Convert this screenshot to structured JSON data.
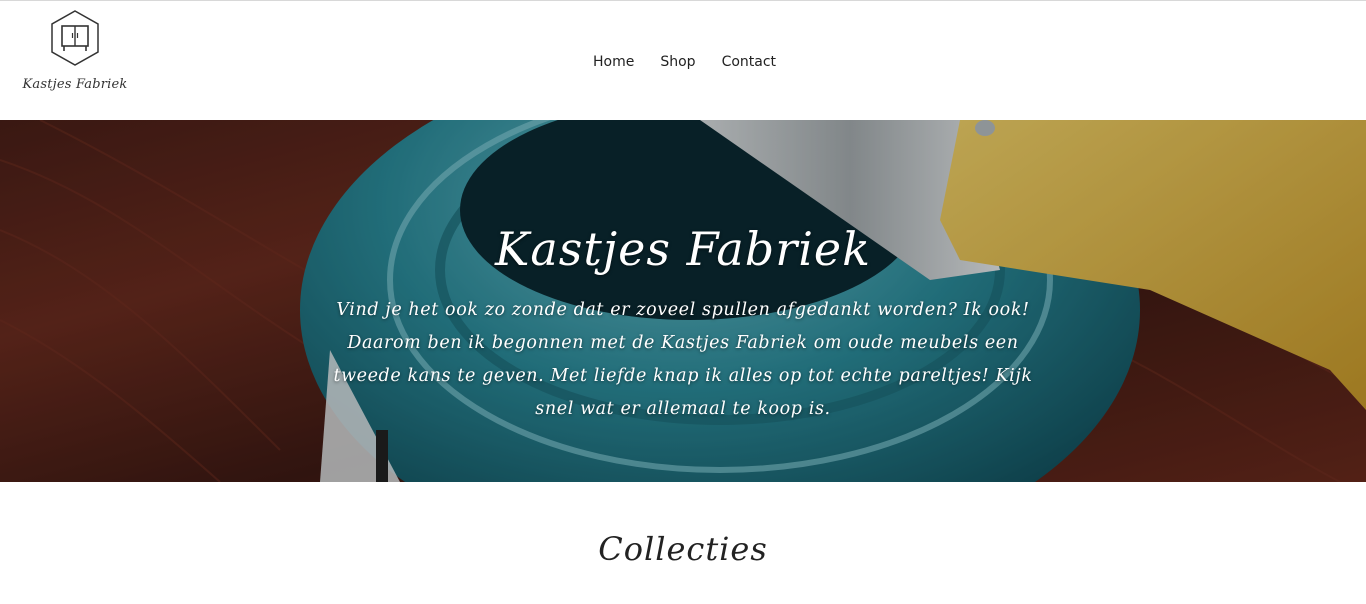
{
  "brand": {
    "name": "Kastjes Fabriek",
    "logo_icon": "cabinet-hexagon-icon"
  },
  "nav": {
    "items": [
      {
        "label": "Home"
      },
      {
        "label": "Shop"
      },
      {
        "label": "Contact"
      }
    ]
  },
  "hero": {
    "title": "Kastjes Fabriek",
    "text": "Vind je het ook zo zonde dat er zoveel spullen afgedankt worden? Ik ook! Daarom ben ik begonnen met de Kastjes Fabriek om oude meubels een tweede kans te geven. Met liefde knap ik alles op tot echte pareltjes! Kijk snel wat er allemaal te koop is.",
    "background": "paint-can-and-brush-photo"
  },
  "section": {
    "title": "Collecties"
  },
  "colors": {
    "text": "#222222",
    "hero_text": "#ffffff",
    "wood": "#5a2a1e",
    "paint": "#2a8a99",
    "brush": "#e8c24a"
  }
}
